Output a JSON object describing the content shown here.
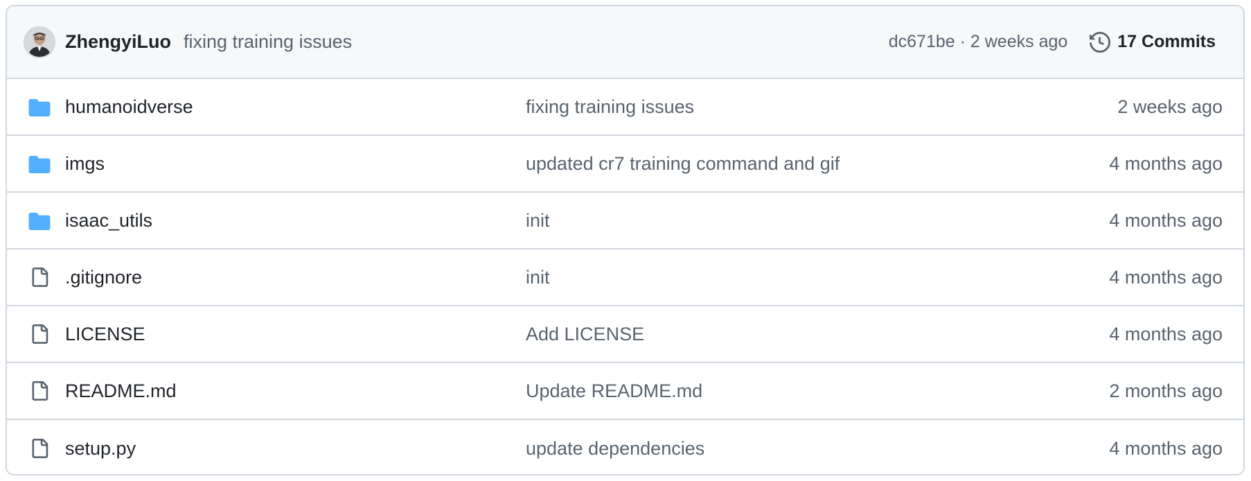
{
  "latest_commit": {
    "author": "ZhengyiLuo",
    "message": "fixing training issues",
    "sha": "dc671be",
    "separator": " · ",
    "time": "2 weeks ago",
    "commits_label": "17 Commits",
    "avatar_icon": "user-avatar",
    "history_icon": "history-icon"
  },
  "files": [
    {
      "type": "dir",
      "icon": "folder-icon",
      "name": "humanoidverse",
      "message": "fixing training issues",
      "time": "2 weeks ago"
    },
    {
      "type": "dir",
      "icon": "folder-icon",
      "name": "imgs",
      "message": "updated cr7 training command and gif",
      "time": "4 months ago"
    },
    {
      "type": "dir",
      "icon": "folder-icon",
      "name": "isaac_utils",
      "message": "init",
      "time": "4 months ago"
    },
    {
      "type": "file",
      "icon": "file-icon",
      "name": ".gitignore",
      "message": "init",
      "time": "4 months ago"
    },
    {
      "type": "file",
      "icon": "file-icon",
      "name": "LICENSE",
      "message": "Add LICENSE",
      "time": "4 months ago"
    },
    {
      "type": "file",
      "icon": "file-icon",
      "name": "README.md",
      "message": "Update README.md",
      "time": "2 months ago"
    },
    {
      "type": "file",
      "icon": "file-icon",
      "name": "setup.py",
      "message": "update dependencies",
      "time": "4 months ago"
    }
  ],
  "colors": {
    "folder": "#54aeff",
    "file_icon": "#59636e",
    "border": "#d0d7de",
    "header_bg": "#f6f8fa",
    "muted_text": "#59636e"
  }
}
